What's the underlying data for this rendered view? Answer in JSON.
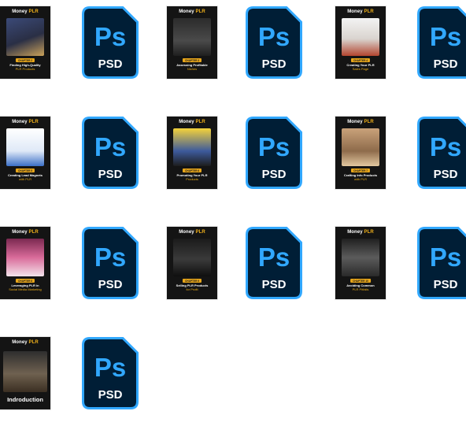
{
  "brand": {
    "name": "Money",
    "suffix": "PLR"
  },
  "colors": {
    "psd_fill": "#001e36",
    "psd_border": "#31a8ff",
    "psd_text": "#31a8ff",
    "accent": "#e8a61a"
  },
  "psd_icon": {
    "big": "Ps",
    "label": "PSD",
    "icon": "photoshop-file-icon"
  },
  "covers": [
    {
      "chapter": "CHAPTER 2",
      "title": "Finding High-Quality",
      "subtitle": "PLR Products",
      "art": "product-box-illustration"
    },
    {
      "chapter": "CHAPTER 3",
      "title": "Assessing Profitable",
      "subtitle": "Niches",
      "art": "businessman-photo"
    },
    {
      "chapter": "CHAPTER 4",
      "title": "Creating Your PLR",
      "subtitle": "Sales Page",
      "art": "woman-laptop-photo"
    },
    {
      "chapter": "CHAPTER 5",
      "title": "Creating Lead Magnets",
      "subtitle": "with PLR",
      "art": "magnet-illustration"
    },
    {
      "chapter": "CHAPTER 6",
      "title": "Promoting Your PLR",
      "subtitle": "Products",
      "art": "megaphone-man-photo"
    },
    {
      "chapter": "CHAPTER 7",
      "title": "Crafting Info Products",
      "subtitle": "with PLR",
      "art": "boxes-photo"
    },
    {
      "chapter": "CHAPTER 8",
      "title": "Leveraging PLR in",
      "subtitle": "Social Media Marketing",
      "art": "woman-phone-photo"
    },
    {
      "chapter": "CHAPTER 9",
      "title": "Selling PLR Products",
      "subtitle": "for Profit",
      "art": "profit-chalkboard-photo"
    },
    {
      "chapter": "CHAPTER 10",
      "title": "Avoiding Common",
      "subtitle": "PLR Pitfalls",
      "art": "man-desk-photo"
    }
  ],
  "intro": {
    "title": "Indroduction",
    "art": "presenter-stage-photo"
  }
}
